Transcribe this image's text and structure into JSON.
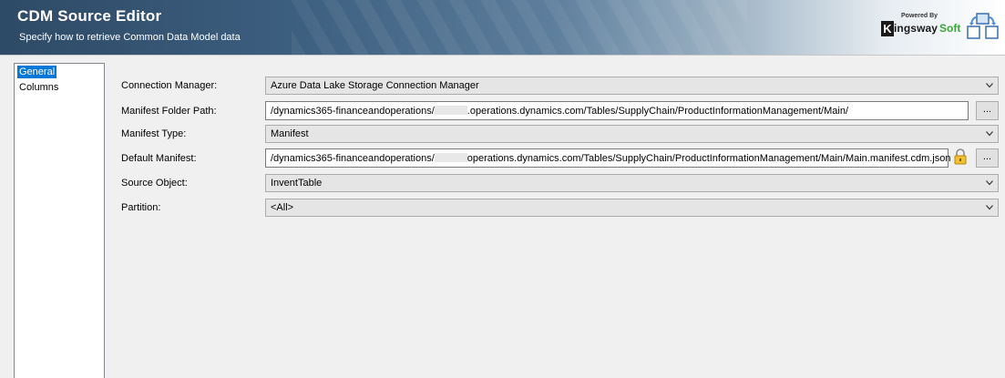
{
  "header": {
    "title": "CDM Source Editor",
    "subtitle": "Specify how to retrieve Common Data Model data"
  },
  "brand": {
    "powered_by": "Powered By",
    "k_initial": "K",
    "name_rest": "ingsway",
    "name_accent": "Soft"
  },
  "nav": {
    "items": [
      {
        "label": "General",
        "selected": true
      },
      {
        "label": "Columns",
        "selected": false
      }
    ]
  },
  "form": {
    "connection_manager": {
      "label": "Connection Manager:",
      "value": "Azure Data Lake Storage Connection Manager"
    },
    "manifest_folder_path": {
      "label": "Manifest Folder Path:",
      "value_prefix": "/dynamics365-financeandoperations/",
      "value_suffix": ".operations.dynamics.com/Tables/SupplyChain/ProductInformationManagement/Main/",
      "browse_label": "..."
    },
    "manifest_type": {
      "label": "Manifest Type:",
      "value": "Manifest"
    },
    "default_manifest": {
      "label": "Default Manifest:",
      "value_prefix": "/dynamics365-financeandoperations/",
      "value_suffix": "operations.dynamics.com/Tables/SupplyChain/ProductInformationManagement/Main/Main.manifest.cdm.json",
      "browse_label": "..."
    },
    "source_object": {
      "label": "Source Object:",
      "value": "InventTable"
    },
    "partition": {
      "label": "Partition:",
      "value": "<All>"
    }
  },
  "colors": {
    "selection": "#0078d7",
    "brand_green": "#3aa53a"
  }
}
